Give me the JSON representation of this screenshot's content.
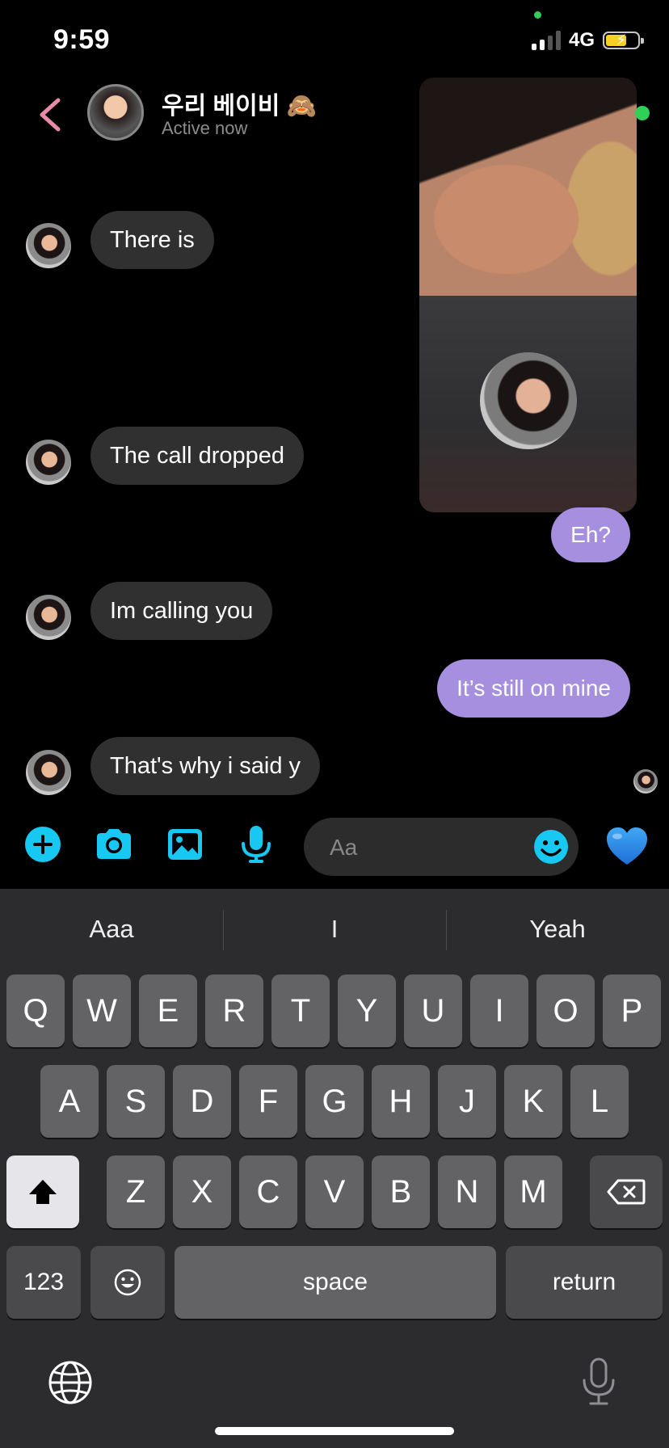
{
  "status_bar": {
    "time": "9:59",
    "network": "4G"
  },
  "header": {
    "contact_name": "우리 베이비 🙈",
    "status": "Active now"
  },
  "messages": [
    {
      "text": "There is",
      "from": "them"
    },
    {
      "text": "The call dropped",
      "from": "them"
    },
    {
      "text": "Eh?",
      "from": "me"
    },
    {
      "text": "Im calling you",
      "from": "them"
    },
    {
      "text": "It’s still on mine",
      "from": "me"
    },
    {
      "text": "That's why i said y",
      "from": "them"
    }
  ],
  "composer": {
    "placeholder": "Aa"
  },
  "keyboard": {
    "suggestions": [
      "Aaa",
      "I",
      "Yeah"
    ],
    "row1": [
      "Q",
      "W",
      "E",
      "R",
      "T",
      "Y",
      "U",
      "I",
      "O",
      "P"
    ],
    "row2": [
      "A",
      "S",
      "D",
      "F",
      "G",
      "H",
      "J",
      "K",
      "L"
    ],
    "row3": [
      "Z",
      "X",
      "C",
      "V",
      "B",
      "N",
      "M"
    ],
    "numbers_key": "123",
    "space_key": "space",
    "return_key": "return"
  },
  "colors": {
    "accent_blue": "#17c9f2",
    "outgoing_bubble": "#a78fe0",
    "incoming_bubble": "#303030",
    "back_arrow": "#e88aa8",
    "online_green": "#2fd058"
  },
  "icons": [
    "back-arrow-icon",
    "plus-icon",
    "camera-icon",
    "image-icon",
    "microphone-icon",
    "emoji-icon",
    "blue-heart-icon",
    "shift-icon",
    "backspace-icon",
    "globe-icon",
    "dictation-icon"
  ]
}
